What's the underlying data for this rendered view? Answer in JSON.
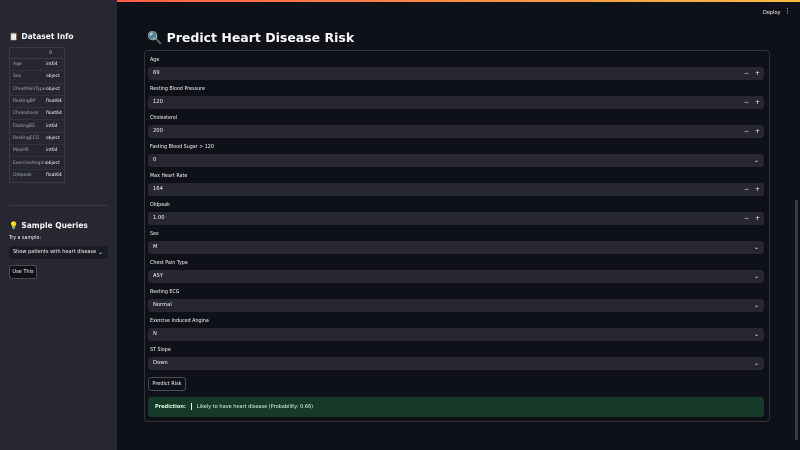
{
  "sidebar": {
    "dataset_title": "Dataset Info",
    "dataset_icon": "clipboard-icon",
    "table_header": [
      "",
      "0"
    ],
    "table_rows": [
      {
        "key": "Age",
        "value": "int64"
      },
      {
        "key": "Sex",
        "value": "object"
      },
      {
        "key": "ChestPainType",
        "value": "object"
      },
      {
        "key": "RestingBP",
        "value": "float64"
      },
      {
        "key": "Cholesterol",
        "value": "float64"
      },
      {
        "key": "FastingBS",
        "value": "int64"
      },
      {
        "key": "RestingECG",
        "value": "object"
      },
      {
        "key": "MaxHR",
        "value": "int64"
      },
      {
        "key": "ExerciseAngina",
        "value": "object"
      },
      {
        "key": "Oldpeak",
        "value": "float64"
      }
    ],
    "samples_title": "Sample Queries",
    "samples_icon": "lightbulb-icon",
    "try_label": "Try a sample:",
    "sample_selected": "Show patients with heart disease",
    "use_button": "Use This"
  },
  "header": {
    "deploy_label": "Deploy",
    "menu_icon": "more-vertical-icon"
  },
  "main": {
    "title": "Predict Heart Disease Risk",
    "title_icon": "magnifier-icon",
    "fields": {
      "age": {
        "label": "Age",
        "value": "69"
      },
      "resting_bp": {
        "label": "Resting Blood Pressure",
        "value": "120"
      },
      "cholesterol": {
        "label": "Cholesterol",
        "value": "200"
      },
      "fasting_bs": {
        "label": "Fasting Blood Sugar > 120",
        "value": "0"
      },
      "max_hr": {
        "label": "Max Heart Rate",
        "value": "164"
      },
      "oldpeak": {
        "label": "Oldpeak",
        "value": "1.00"
      },
      "sex": {
        "label": "Sex",
        "value": "M"
      },
      "chest_pain": {
        "label": "Chest Pain Type",
        "value": "ASY"
      },
      "resting_ecg": {
        "label": "Resting ECG",
        "value": "Normal"
      },
      "exercise_angina": {
        "label": "Exercise Induced Angina",
        "value": "N"
      },
      "st_slope": {
        "label": "ST Slope",
        "value": "Down"
      }
    },
    "predict_button": "Predict Risk",
    "result_label": "Prediction:",
    "result_text": "Likely to have heart disease (Probability: 0.66)"
  },
  "colors": {
    "background": "#0e1117",
    "sidebar": "#262730",
    "input": "#262730",
    "success_bg": "#173928",
    "accent": "#ff4b4b"
  }
}
